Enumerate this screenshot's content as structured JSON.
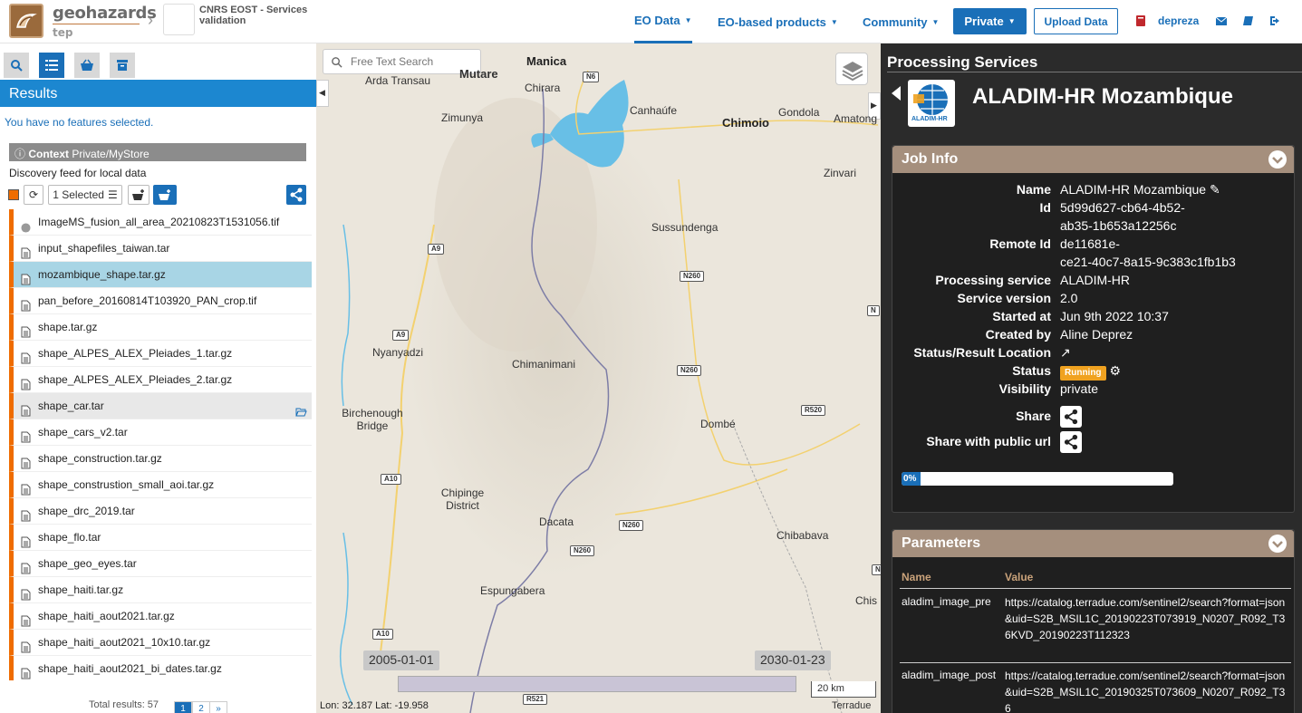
{
  "header": {
    "logo_text": "geohazards",
    "logo_sub": "tep",
    "context_title": "CNRS EOST - Services validation",
    "nav": [
      {
        "label": "EO Data"
      },
      {
        "label": "EO-based products"
      },
      {
        "label": "Community"
      }
    ],
    "private_label": "Private",
    "upload_label": "Upload Data",
    "username": "depreza"
  },
  "left": {
    "results_title": "Results",
    "no_features": "You have no features selected.",
    "context_label": "Context",
    "context_value": "Private/MyStore",
    "discovery": "Discovery feed for local data",
    "selected_label": "1 Selected",
    "items": [
      {
        "name": "ImageMS_fusion_all_area_20210823T1531056.tif",
        "icon": "globe-icon"
      },
      {
        "name": "input_shapefiles_taiwan.tar",
        "icon": "file-icon"
      },
      {
        "name": "mozambique_shape.tar.gz",
        "icon": "file-icon",
        "selected": true
      },
      {
        "name": "pan_before_20160814T103920_PAN_crop.tif",
        "icon": "file-icon"
      },
      {
        "name": "shape.tar.gz",
        "icon": "file-icon"
      },
      {
        "name": "shape_ALPES_ALEX_Pleiades_1.tar.gz",
        "icon": "file-icon"
      },
      {
        "name": "shape_ALPES_ALEX_Pleiades_2.tar.gz",
        "icon": "file-icon"
      },
      {
        "name": "shape_car.tar",
        "icon": "file-icon",
        "hover": true
      },
      {
        "name": "shape_cars_v2.tar",
        "icon": "file-icon"
      },
      {
        "name": "shape_construction.tar.gz",
        "icon": "file-icon"
      },
      {
        "name": "shape_construstion_small_aoi.tar.gz",
        "icon": "file-icon"
      },
      {
        "name": "shape_drc_2019.tar",
        "icon": "file-icon"
      },
      {
        "name": "shape_flo.tar",
        "icon": "file-icon"
      },
      {
        "name": "shape_geo_eyes.tar",
        "icon": "file-icon"
      },
      {
        "name": "shape_haiti.tar.gz",
        "icon": "file-icon"
      },
      {
        "name": "shape_haiti_aout2021.tar.gz",
        "icon": "file-icon"
      },
      {
        "name": "shape_haiti_aout2021_10x10.tar.gz",
        "icon": "file-icon"
      },
      {
        "name": "shape_haiti_aout2021_bi_dates.tar.gz",
        "icon": "file-icon"
      }
    ],
    "total_results": "Total results: 57",
    "pages": [
      "1",
      "2",
      "»"
    ]
  },
  "map": {
    "search_placeholder": "Free Text Search",
    "places": [
      "Manica",
      "Mutare",
      "Chirara",
      "Arda Transau",
      "Zimunya",
      "Canhaúfe",
      "Chimoio",
      "Gondola",
      "Amatong",
      "Zinvari",
      "Sussundenga",
      "Nyanyadzi",
      "Chimanimani",
      "Birchenough Bridge",
      "Dombé",
      "Chipinge District",
      "Dacata",
      "Chibabava",
      "Espungabera",
      "Chis"
    ],
    "roads": [
      "N6",
      "A9",
      "N260",
      "A9",
      "N260",
      "R520",
      "A10",
      "N260",
      "N260",
      "A10",
      "R521",
      "N",
      "N"
    ],
    "timeline_start": "2005-01-01",
    "timeline_end": "2030-01-23",
    "scale": "20 km",
    "coords": "Lon: 32.187 Lat: -19.958",
    "attribution": "Terradue"
  },
  "right": {
    "section_title": "Processing Services",
    "service_title": "ALADIM-HR Mozambique",
    "logo_caption": "ALADIM-HR",
    "job_info_title": "Job Info",
    "job": {
      "name_k": "Name",
      "name_v": "ALADIM-HR Mozambique",
      "id_k": "Id",
      "id_v1": "5d99d627-cb64-4b52-",
      "id_v2": "ab35-1b653a12256c",
      "remote_k": "Remote Id",
      "remote_v1": "de11681e-",
      "remote_v2": "ce21-40c7-8a15-9c383c1fb1b3",
      "proc_k": "Processing service",
      "proc_v": "ALADIM-HR",
      "ver_k": "Service version",
      "ver_v": "2.0",
      "start_k": "Started at",
      "start_v": "Jun 9th 2022 10:37",
      "by_k": "Created by",
      "by_v": "Aline Deprez",
      "loc_k": "Status/Result Location",
      "status_k": "Status",
      "status_v": "Running",
      "vis_k": "Visibility",
      "vis_v": "private",
      "share_k": "Share",
      "share_pub_k": "Share with public url"
    },
    "progress_label": "0%",
    "progress_fraction": 0.07,
    "params_title": "Parameters",
    "param_headers": {
      "name": "Name",
      "value": "Value"
    },
    "params": [
      {
        "name": "aladim_image_pre",
        "value": "https://catalog.terradue.com/sentinel2/search?format=json&uid=S2B_MSIL1C_20190223T073919_N0207_R092_T36KVD_20190223T112323"
      },
      {
        "name": "aladim_image_post",
        "value": "https://catalog.terradue.com/sentinel2/search?format=json&uid=S2B_MSIL1C_20190325T073609_N0207_R092_T36"
      }
    ]
  },
  "colors": {
    "brand_blue": "#1a6fb8",
    "results_blue": "#1c87d0",
    "orange": "#ef6c00",
    "panel_header": "#a58f7d",
    "running": "#f0a220"
  }
}
